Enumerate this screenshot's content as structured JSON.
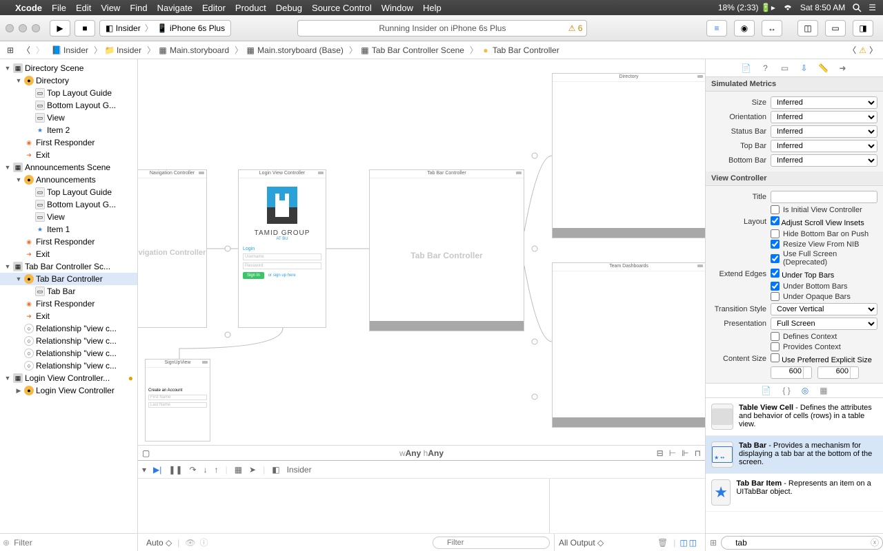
{
  "menubar": {
    "app": "Xcode",
    "items": [
      "File",
      "Edit",
      "View",
      "Find",
      "Navigate",
      "Editor",
      "Product",
      "Debug",
      "Source Control",
      "Window",
      "Help"
    ],
    "battery": "18% (2:33)",
    "clock": "Sat 8:50 AM"
  },
  "toolbar": {
    "scheme_target": "Insider",
    "scheme_device": "iPhone 6s Plus",
    "activity": "Running Insider on iPhone 6s Plus",
    "warning_count": "6"
  },
  "jumpbar": {
    "segments": [
      "Insider",
      "Insider",
      "Main.storyboard",
      "Main.storyboard (Base)",
      "Tab Bar Controller Scene",
      "Tab Bar Controller"
    ]
  },
  "navigator": {
    "filter_placeholder": "Filter",
    "tree": [
      {
        "l": 0,
        "t": "scene",
        "label": "Directory Scene",
        "exp": true
      },
      {
        "l": 1,
        "t": "vc",
        "label": "Directory",
        "exp": true
      },
      {
        "l": 2,
        "t": "tlg",
        "label": "Top Layout Guide"
      },
      {
        "l": 2,
        "t": "tlg",
        "label": "Bottom Layout G..."
      },
      {
        "l": 2,
        "t": "view",
        "label": "View"
      },
      {
        "l": 2,
        "t": "item",
        "label": "Item 2"
      },
      {
        "l": 1,
        "t": "fr",
        "label": "First Responder"
      },
      {
        "l": 1,
        "t": "exit",
        "label": "Exit"
      },
      {
        "l": 0,
        "t": "scene",
        "label": "Announcements Scene",
        "exp": true
      },
      {
        "l": 1,
        "t": "vc",
        "label": "Announcements",
        "exp": true
      },
      {
        "l": 2,
        "t": "tlg",
        "label": "Top Layout Guide"
      },
      {
        "l": 2,
        "t": "tlg",
        "label": "Bottom Layout G..."
      },
      {
        "l": 2,
        "t": "view",
        "label": "View"
      },
      {
        "l": 2,
        "t": "item",
        "label": "Item 1"
      },
      {
        "l": 1,
        "t": "fr",
        "label": "First Responder"
      },
      {
        "l": 1,
        "t": "exit",
        "label": "Exit"
      },
      {
        "l": 0,
        "t": "scene",
        "label": "Tab Bar Controller Sc...",
        "exp": true
      },
      {
        "l": 1,
        "t": "vc",
        "label": "Tab Bar Controller",
        "exp": true,
        "sel": true
      },
      {
        "l": 2,
        "t": "tabbar",
        "label": "Tab Bar"
      },
      {
        "l": 1,
        "t": "fr",
        "label": "First Responder"
      },
      {
        "l": 1,
        "t": "exit",
        "label": "Exit"
      },
      {
        "l": 1,
        "t": "rel",
        "label": "Relationship \"view c..."
      },
      {
        "l": 1,
        "t": "rel",
        "label": "Relationship \"view c..."
      },
      {
        "l": 1,
        "t": "rel",
        "label": "Relationship \"view c..."
      },
      {
        "l": 1,
        "t": "rel",
        "label": "Relationship \"view c..."
      },
      {
        "l": 0,
        "t": "scene",
        "label": "Login View Controller...",
        "exp": true,
        "badge": true
      },
      {
        "l": 1,
        "t": "vc",
        "label": "Login View Controller",
        "exp": false
      }
    ]
  },
  "canvas": {
    "size_class": "wAny hAny",
    "scenes": {
      "nav": {
        "title": "Navigation Controller",
        "placeholder": "vigation Controller"
      },
      "login": {
        "title": "Login View Controller",
        "brand_top": "TAMID GROUP",
        "brand_sub": "AT BU",
        "login": "Login",
        "user_ph": "Username",
        "pass_ph": "Password",
        "signin": "Sign In",
        "signup": "or sign up here"
      },
      "tabbar": {
        "title": "Tab Bar Controller",
        "placeholder": "Tab Bar Controller"
      },
      "directory": {
        "title": "Directory"
      },
      "team": {
        "title": "Team Dashboards"
      },
      "signup": {
        "title": "SignUpView",
        "h": "Create an Account",
        "f1": "First Name",
        "f2": "Last Name"
      }
    }
  },
  "debug": {
    "process": "Insider",
    "auto": "Auto ◇",
    "filter_placeholder": "Filter",
    "output": "All Output ◇"
  },
  "inspector": {
    "sections": {
      "sim_metrics": "Simulated Metrics",
      "view_controller": "View Controller"
    },
    "metrics": {
      "size_label": "Size",
      "size_value": "Inferred",
      "orient_label": "Orientation",
      "orient_value": "Inferred",
      "status_label": "Status Bar",
      "status_value": "Inferred",
      "top_label": "Top Bar",
      "top_value": "Inferred",
      "bottom_label": "Bottom Bar",
      "bottom_value": "Inferred"
    },
    "vc": {
      "title_label": "Title",
      "title_value": "",
      "initial": "Is Initial View Controller",
      "layout_label": "Layout",
      "adjust": "Adjust Scroll View Insets",
      "hide": "Hide Bottom Bar on Push",
      "resize": "Resize View From NIB",
      "fullscreen": "Use Full Screen (Deprecated)",
      "extend_label": "Extend Edges",
      "under_top": "Under Top Bars",
      "under_bottom": "Under Bottom Bars",
      "under_opaque": "Under Opaque Bars",
      "transition_label": "Transition Style",
      "transition_value": "Cover Vertical",
      "presentation_label": "Presentation",
      "presentation_value": "Full Screen",
      "defines": "Defines Context",
      "provides": "Provides Context",
      "content_size_label": "Content Size",
      "use_pref": "Use Preferred Explicit Size",
      "w": "600",
      "h": "600"
    }
  },
  "library": {
    "items": [
      {
        "name": "Table View Cell",
        "desc": " - Defines the attributes and behavior of cells (rows) in a table view."
      },
      {
        "name": "Tab Bar",
        "desc": " - Provides a mechanism for displaying a tab bar at the bottom of the screen.",
        "sel": true
      },
      {
        "name": "Tab Bar Item",
        "desc": " - Represents an item on a UITabBar object."
      }
    ],
    "filter_value": "tab"
  }
}
